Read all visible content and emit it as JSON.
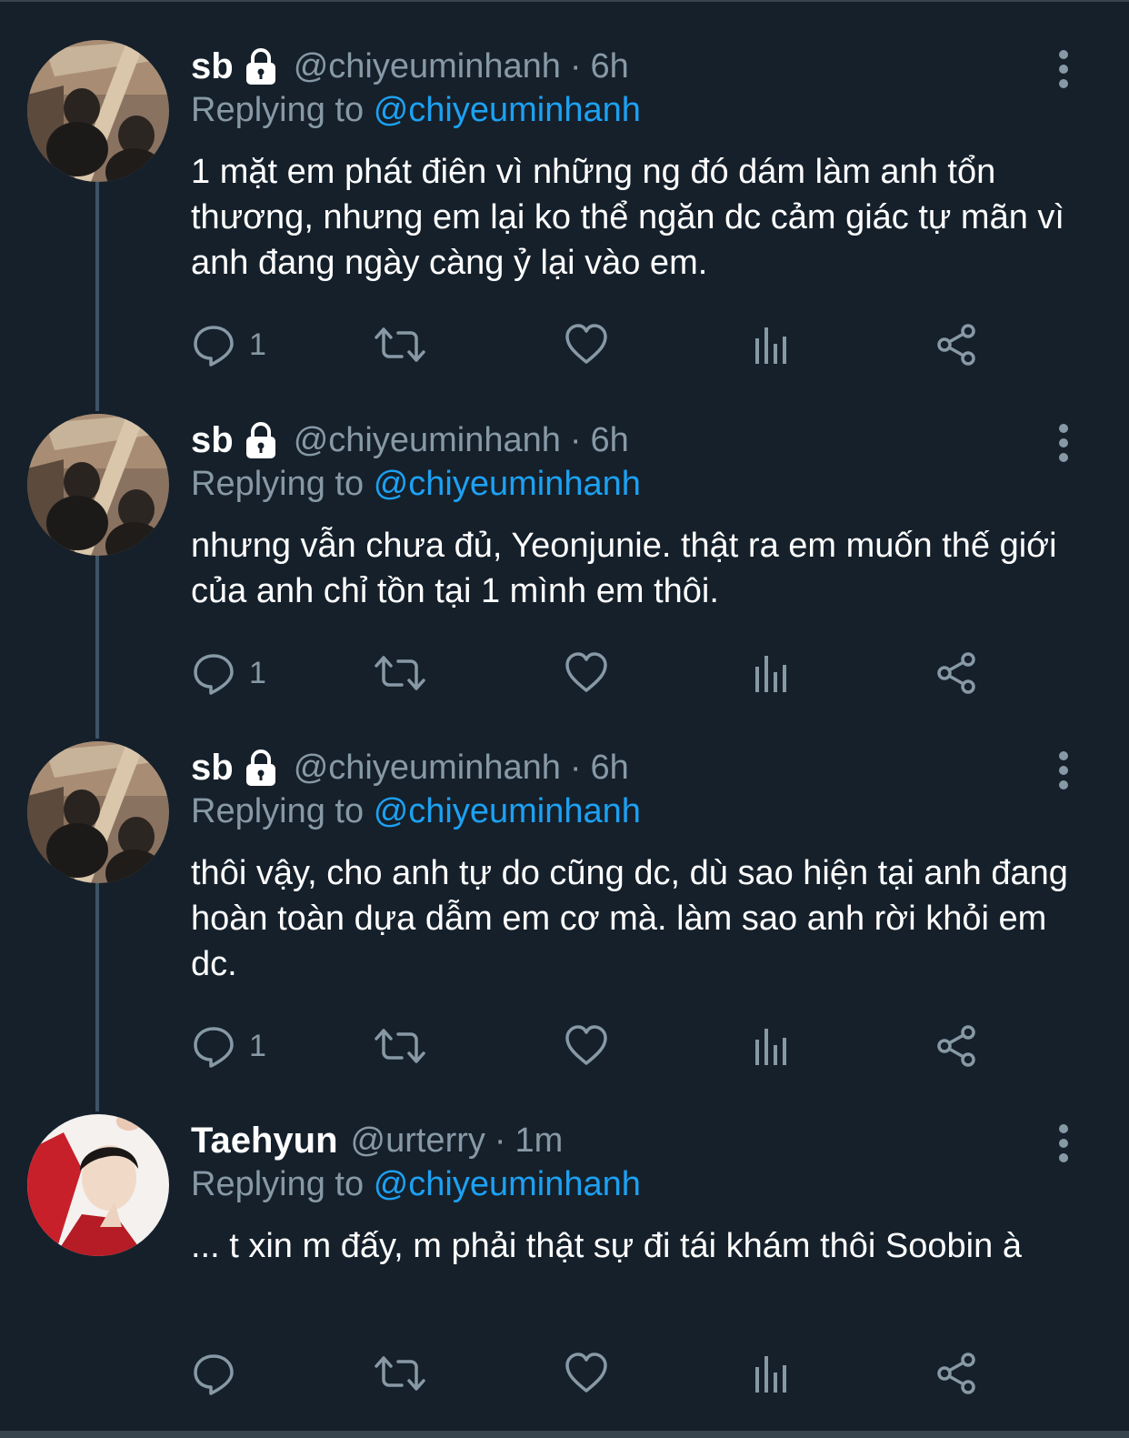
{
  "tweets": [
    {
      "name": "sb",
      "handle": "@chiyeuminhanh",
      "separator": "·",
      "time": "6h",
      "replying_prefix": "Replying to",
      "replying_to": "@chiyeuminhanh",
      "text": "1 mặt em phát điên vì những ng đó dám làm anh tổn thương, nhưng em lại ko thể ngăn dc cảm giác tự mãn vì anh đang ngày càng ỷ lại vào em.",
      "reply_count": "1",
      "locked": true,
      "avatar": "couple-photo-avatar"
    },
    {
      "name": "sb",
      "handle": "@chiyeuminhanh",
      "separator": "·",
      "time": "6h",
      "replying_prefix": "Replying to",
      "replying_to": "@chiyeuminhanh",
      "text": "nhưng vẫn chưa đủ, Yeonjunie. thật ra em muốn thế giới của anh chỉ tồn tại 1 mình em thôi.",
      "reply_count": "1",
      "locked": true,
      "avatar": "couple-photo-avatar"
    },
    {
      "name": "sb",
      "handle": "@chiyeuminhanh",
      "separator": "·",
      "time": "6h",
      "replying_prefix": "Replying to",
      "replying_to": "@chiyeuminhanh",
      "text": "thôi vậy, cho anh tự do cũng dc, dù sao hiện tại anh đang hoàn toàn dựa dẫm em cơ mà. làm sao anh rời khỏi em dc.",
      "reply_count": "1",
      "locked": true,
      "avatar": "couple-photo-avatar"
    },
    {
      "name": "Taehyun",
      "handle": "@urterry",
      "separator": "·",
      "time": "1m",
      "replying_prefix": "Replying to",
      "replying_to": "@chiyeuminhanh",
      "text": "... t xin m đấy, m phải thật sự đi tái khám thôi Soobin à",
      "reply_count": "",
      "locked": false,
      "avatar": "red-outfit-avatar"
    }
  ],
  "icons": {
    "reply": "reply-icon",
    "retweet": "retweet-icon",
    "like": "heart-icon",
    "analytics": "analytics-icon",
    "share": "share-icon",
    "more": "more-vertical-icon",
    "lock": "lock-icon"
  },
  "colors": {
    "background": "#15202b",
    "secondary_text": "#8899a6",
    "accent": "#1da1f2",
    "thread_line": "#3d5466"
  }
}
